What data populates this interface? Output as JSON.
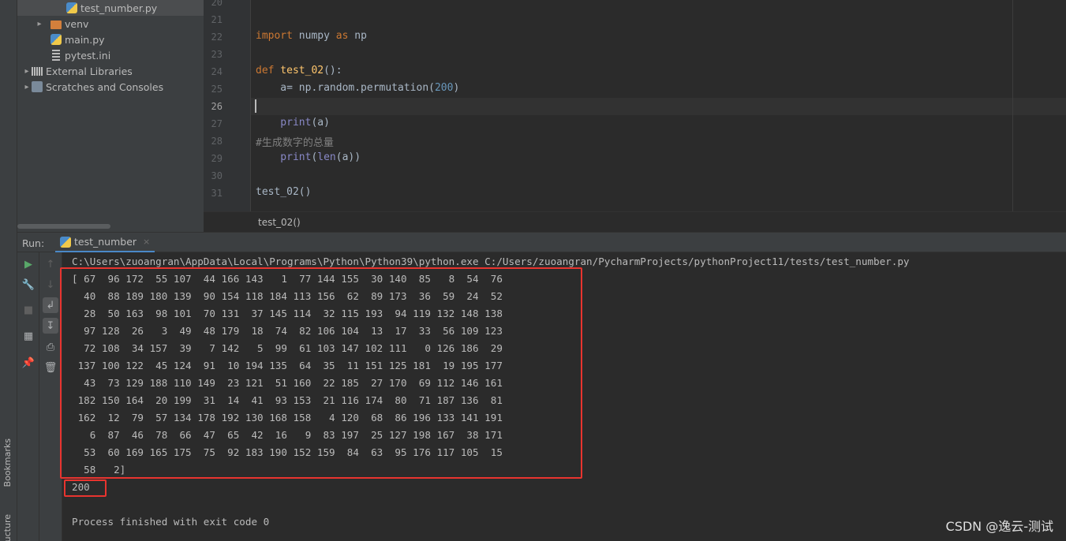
{
  "side_strip": {
    "bookmarks": "Bookmarks",
    "structure": "ucture"
  },
  "project_tree": {
    "items": [
      {
        "label": "test_number.py",
        "icon": "python-file-icon"
      },
      {
        "label": "venv",
        "icon": "folder-icon"
      },
      {
        "label": "main.py",
        "icon": "python-file-icon"
      },
      {
        "label": "pytest.ini",
        "icon": "ini-file-icon"
      },
      {
        "label": "External Libraries",
        "icon": "library-icon"
      },
      {
        "label": "Scratches and Consoles",
        "icon": "scratches-icon"
      }
    ]
  },
  "editor": {
    "line_numbers": [
      "20",
      "21",
      "22",
      "23",
      "24",
      "25",
      "26",
      "27",
      "28",
      "29",
      "30",
      "31"
    ],
    "code": {
      "l22_kw1": "import",
      "l22_mid": " numpy ",
      "l22_kw2": "as",
      "l22_end": " np",
      "l24_kw": "def",
      "l24_fn": " test_02",
      "l24_end": "():",
      "l25_a": "    a= np.random.permutation(",
      "l25_num": "200",
      "l25_end": ")",
      "l27_fn": "    print",
      "l27_end": "(a)",
      "l28_comment": "#生成数字的总量",
      "l29_fn": "    print",
      "l29_p": "(",
      "l29_len": "len",
      "l29_end": "(a))",
      "l31": "test_02()"
    },
    "breadcrumb": "test_02()"
  },
  "run_panel": {
    "label": "Run:",
    "tab": "test_number",
    "close_glyph": "×",
    "command": "C:\\Users\\zuoangran\\AppData\\Local\\Programs\\Python\\Python39\\python.exe C:/Users/zuoangran/PycharmProjects/pythonProject11/tests/test_number.py",
    "output_lines": [
      "[ 67  96 172  55 107  44 166 143   1  77 144 155  30 140  85   8  54  76",
      "  40  88 189 180 139  90 154 118 184 113 156  62  89 173  36  59  24  52",
      "  28  50 163  98 101  70 131  37 145 114  32 115 193  94 119 132 148 138",
      "  97 128  26   3  49  48 179  18  74  82 106 104  13  17  33  56 109 123",
      "  72 108  34 157  39   7 142   5  99  61 103 147 102 111   0 126 186  29",
      " 137 100 122  45 124  91  10 194 135  64  35  11 151 125 181  19 195 177",
      "  43  73 129 188 110 149  23 121  51 160  22 185  27 170  69 112 146 161",
      " 182 150 164  20 199  31  14  41  93 153  21 116 174  80  71 187 136  81",
      " 162  12  79  57 134 178 192 130 168 158   4 120  68  86 196 133 141 191",
      "   6  87  46  78  66  47  65  42  16   9  83 197  25 127 198 167  38 171",
      "  53  60 169 165 175  75  92 183 190 152 159  84  63  95 176 117 105  15",
      "  58   2]"
    ],
    "length_output": "200",
    "exit_message": "Process finished with exit code 0"
  },
  "watermark": "CSDN @逸云-测试",
  "colors": {
    "highlight": "#e8342f",
    "keyword": "#cc7832",
    "function": "#ffc66d",
    "number": "#6897bb"
  }
}
